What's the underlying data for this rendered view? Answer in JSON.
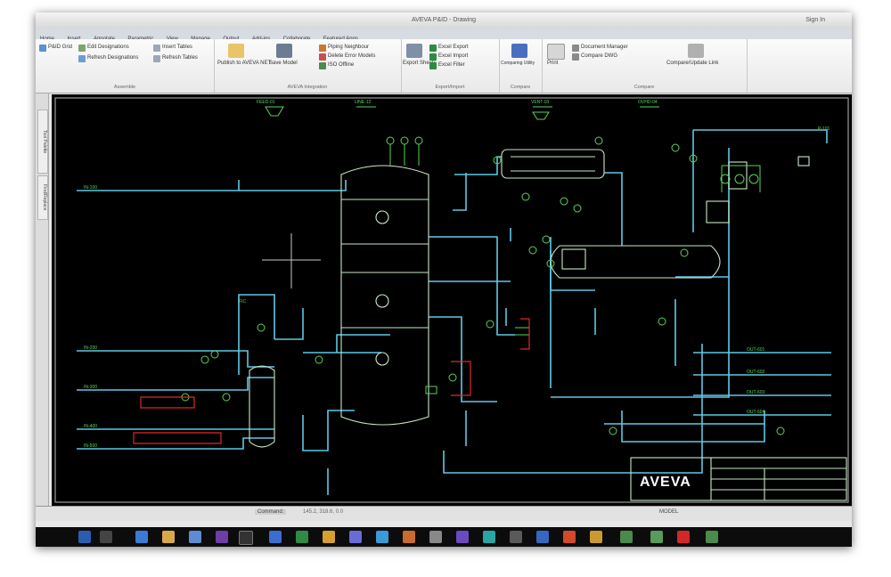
{
  "window": {
    "title": "AVEVA P&ID - Drawing",
    "user": "Sign In"
  },
  "menu_tabs": [
    "Home",
    "Insert",
    "Annotate",
    "Parametric",
    "View",
    "Manage",
    "Output",
    "Add-ins",
    "Collaborate",
    "Featured Apps"
  ],
  "ribbon": {
    "groups": [
      {
        "label": "Assemble",
        "items": [
          "P&ID Grid",
          "Edit Designations",
          "Refresh Designations",
          "Insert Tables",
          "Refresh Tables"
        ]
      },
      {
        "label": "AVEVA Integration",
        "items": [
          "Publish to AVEVA NET",
          "Save Model",
          "Piping Neighbour",
          "Delete Error Models",
          "ISO Offline"
        ]
      },
      {
        "label": "Export/Import",
        "items": [
          "Excel Export",
          "Excel Import",
          "Excel Filter",
          "Export Sheets"
        ]
      },
      {
        "label": "Compare",
        "items": [
          "Comparing Utility"
        ]
      },
      {
        "label": "Compare",
        "items": [
          "Print",
          "Document Manager",
          "Compare DWG",
          "Compare/Update Link"
        ]
      }
    ]
  },
  "side_tabs": [
    "Tool Palette",
    "Find/Replace"
  ],
  "drawing": {
    "logo": "AVEVA",
    "colors": {
      "background": "#000000",
      "pipe": "#5fc8e6",
      "equipment": "#c8e8c8",
      "instrument": "#5ad45a",
      "alarm": "#e02828"
    }
  },
  "status": {
    "command": "Command:",
    "coords": "145.2, 318.6, 0.0",
    "zoom": "MODEL"
  },
  "taskbar": {
    "icons": [
      "start-icon",
      "search-icon",
      "task-view-icon",
      "folder-icon",
      "edge-icon",
      "outlook-icon",
      "word-icon",
      "excel-icon",
      "chrome-icon",
      "teams-icon",
      "powerpoint-icon",
      "autocad-icon",
      "settings-icon"
    ]
  }
}
